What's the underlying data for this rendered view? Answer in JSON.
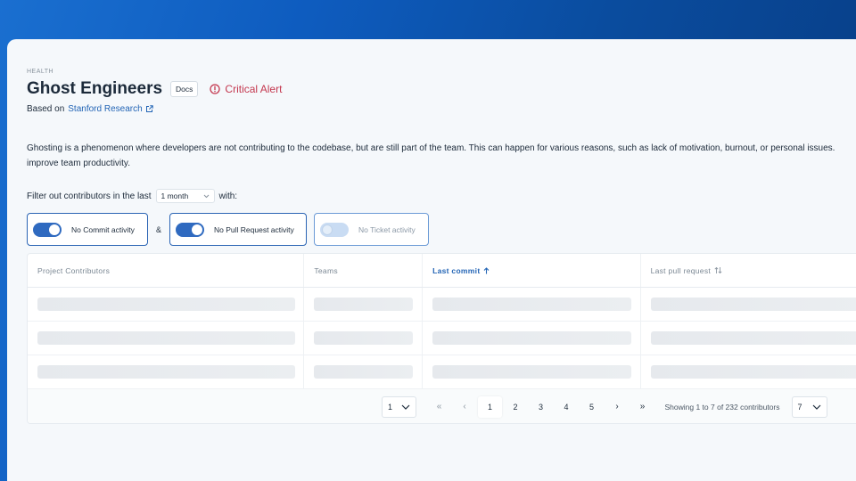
{
  "breadcrumb": "HEALTH",
  "page_title": "Ghost Engineers",
  "docs_label": "Docs",
  "alert_label": "Critical Alert",
  "based_on": {
    "prefix": "Based on",
    "link": "Stanford Research"
  },
  "description": "Ghosting is a phenomenon where developers are not contributing to the codebase, but are still part of the team. This can happen for various reasons, such as lack of motivation, burnout, or personal issues. improve team productivity.",
  "filter": {
    "prefix": "Filter out contributors in the last",
    "period": "1 month",
    "suffix": "with:",
    "toggles": [
      {
        "label": "No Commit activity",
        "on": true,
        "enabled": true
      },
      {
        "label": "No Pull Request activity",
        "on": true,
        "enabled": true
      },
      {
        "label": "No Ticket activity",
        "on": false,
        "enabled": false
      }
    ],
    "joiner": "&"
  },
  "table": {
    "columns": [
      "Project Contributors",
      "Teams",
      "Last commit",
      "Last pull request"
    ],
    "sorted_column": "Last commit",
    "sort_direction": "ascending",
    "loading_rows": 3
  },
  "pagination": {
    "page_select": "1",
    "pages": [
      "1",
      "2",
      "3",
      "4",
      "5"
    ],
    "current_page": "1",
    "first_label": "«",
    "prev_label": "‹",
    "next_label": "›",
    "last_label": "»",
    "showing": "Showing 1 to 7 of 232 contributors",
    "page_size": "7"
  },
  "colors": {
    "accent": "#2264b5",
    "alert": "#c4384f",
    "background_gradient": "#0e5cbf"
  }
}
